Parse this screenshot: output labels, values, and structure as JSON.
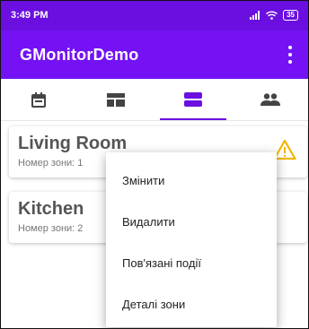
{
  "status_bar": {
    "time": "3:49 PM",
    "battery": "35"
  },
  "app_bar": {
    "title": "GMonitorDemo"
  },
  "tabs": [
    {
      "icon": "calendar-icon",
      "active": false
    },
    {
      "icon": "dashboard-icon",
      "active": false
    },
    {
      "icon": "list-icon",
      "active": true
    },
    {
      "icon": "people-icon",
      "active": false
    }
  ],
  "zones": [
    {
      "name": "Living Room",
      "zone_number_label": "Номер зони: 1",
      "warning_icon": "warning-icon"
    },
    {
      "name": "Kitchen",
      "zone_number_label": "Номер зони: 2"
    }
  ],
  "context_menu": {
    "items": [
      {
        "label": "Змінити"
      },
      {
        "label": "Видалити"
      },
      {
        "label": "Пов'язані події"
      },
      {
        "label": "Деталі зони"
      }
    ]
  },
  "colors": {
    "status_bar": "#6a0fe0",
    "app_bar": "#7412f5",
    "accent": "#6a0fe0",
    "warning": "#f2b600"
  }
}
